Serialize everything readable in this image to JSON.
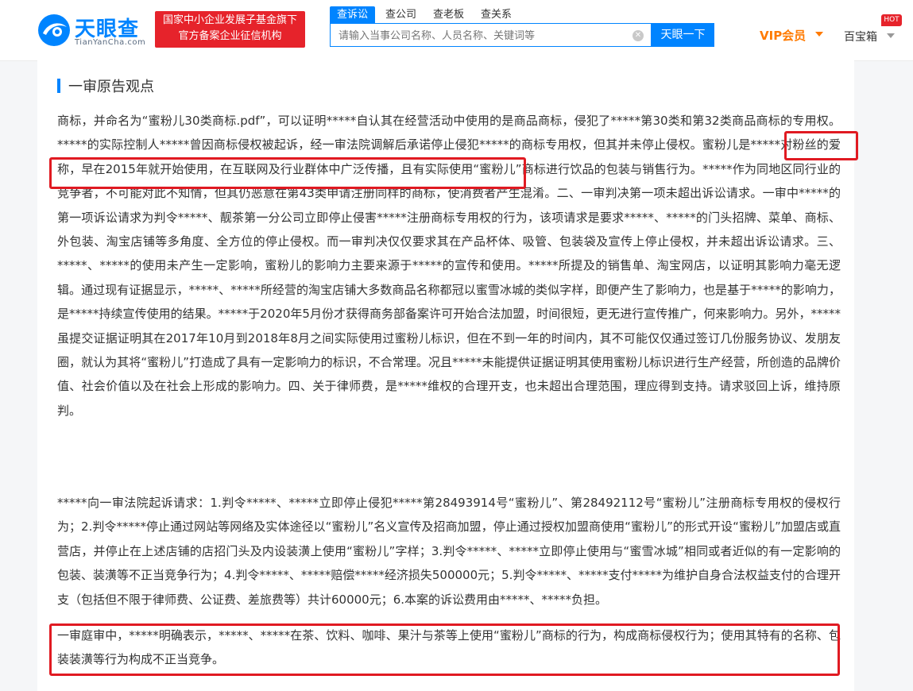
{
  "header": {
    "logo_cn": "天眼查",
    "logo_en": "TianYanCha.com",
    "badge_line1": "国家中小企业发展子基金旗下",
    "badge_line2": "官方备案企业征信机构",
    "tabs": [
      "查诉讼",
      "查公司",
      "查老板",
      "查关系"
    ],
    "active_tab": 0,
    "search_placeholder": "请输入当事公司名称、人员名称、关键词等",
    "search_button": "天眼一下",
    "vip_label": "VIP会员",
    "baibao_label": "百宝箱",
    "hot_badge": "HOT"
  },
  "section": {
    "title": "一审原告观点"
  },
  "paragraphs": {
    "p1": "商标，并命名为“蜜粉儿30类商标.pdf”，可以证明*****自认其在经营活动中使用的是商品商标，侵犯了*****第30类和第32类商品商标的专用权。*****的实际控制人*****曾因商标侵权被起诉，经一审法院调解后承诺停止侵犯*****的商标专用权，但其并未停止侵权。蜜粉儿是*****对粉丝的爱称，早在2015年就开始使用，在互联网及行业群体中广泛传播，且有实际使用“蜜粉儿”商标进行饮品的包装与销售行为。*****作为同地区同行业的竞争者，不可能对此不知情，但其仍恶意在第43类申请注册同样的商标，使消费者产生混淆。二、一审判决第一项未超出诉讼请求。一审中*****的第一项诉讼请求为判令*****、靓茶第一分公司立即停止侵害*****注册商标专用权的行为，该项请求是要求*****、*****的门头招牌、菜单、商标、外包装、淘宝店铺等多角度、全方位的停止侵权。而一审判决仅仅要求其在产品杯体、吸管、包装袋及宣传上停止侵权，并未超出诉讼请求。三、*****、*****的使用未产生一定影响，蜜粉儿的影响力主要来源于*****的宣传和使用。*****所提及的销售单、淘宝网店，以证明其影响力毫无逻辑。通过现有证据显示，*****、*****所经营的淘宝店铺大多数商品名称都冠以蜜雪冰城的类似字样，即便产生了影响力，也是基于*****的影响力，是*****持续宣传使用的结果。*****于2020年5月份才获得商务部备案许可开始合法加盟，时间很短，更无进行宣传推广，何来影响力。另外，*****虽提交证据证明其在2017年10月到2018年8月之间实际使用过蜜粉儿标识，但在不到一年的时间内，其不可能仅仅通过签订几份服务协议、发朋友圈，就认为其将“蜜粉儿”打造成了具有一定影响力的标识，不合常理。况且*****未能提供证据证明其使用蜜粉儿标识进行生产经营，所创造的品牌价值、社会价值以及在社会上形成的影响力。四、关于律师费，是*****维权的合理开支，也未超出合理范围，理应得到支持。请求驳回上诉，维持原判。",
    "p2": "*****向一审法院起诉请求：1.判令*****、*****立即停止侵犯*****第28493914号“蜜粉儿”、第28492112号“蜜粉儿”注册商标专用权的侵权行为；2.判令*****停止通过网站等网络及实体途径以“蜜粉儿”名义宣传及招商加盟，停止通过授权加盟商使用“蜜粉儿”的形式开设“蜜粉儿”加盟店或直营店，并停止在上述店铺的店招门头及内设装潢上使用“蜜粉儿”字样；3.判令*****、*****立即停止使用与“蜜雪冰城”相同或者近似的有一定影响的包装、装潢等不正当竞争行为；4.判令*****、*****赔偿*****经济损失500000元；5.判令*****、*****支付*****为维护自身合法权益支付的合理开支（包括但不限于律师费、公证费、差旅费等）共计60000元；6.本案的诉讼费用由*****、*****负担。",
    "p3": "一审庭审中，*****明确表示，*****、*****在茶、饮料、咖啡、果汁与茶等上使用“蜜粉儿”商标的行为，构成商标侵权行为；使用其特有的名称、包装装潢等行为构成不正当竞争。"
  },
  "colors": {
    "brand_blue": "#0084ff",
    "badge_red": "#e6232b",
    "highlight_red": "#e01a22",
    "vip_orange": "#ff7a00"
  }
}
